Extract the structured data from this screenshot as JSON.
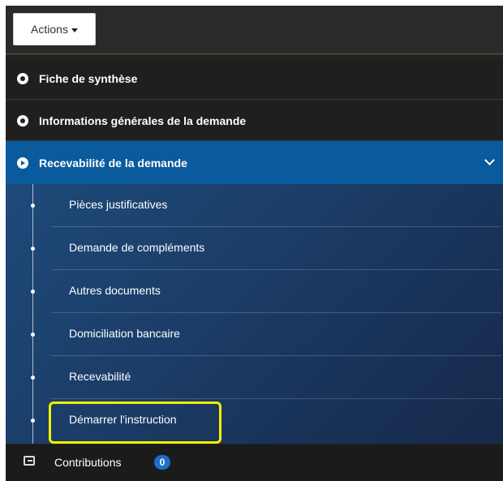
{
  "actions": {
    "label": "Actions"
  },
  "sections": [
    {
      "label": "Fiche de synthèse"
    },
    {
      "label": "Informations générales de la demande"
    },
    {
      "label": "Recevabilité de la demande",
      "expanded": true
    }
  ],
  "submenu": [
    {
      "label": "Pièces justificatives"
    },
    {
      "label": "Demande de compléments"
    },
    {
      "label": "Autres documents"
    },
    {
      "label": "Domiciliation bancaire"
    },
    {
      "label": "Recevabilité"
    },
    {
      "label": "Démarrer l'instruction",
      "highlighted": true
    }
  ],
  "footer": {
    "label": "Contributions",
    "count": "0"
  },
  "colors": {
    "active_section": "#0a5b9e",
    "highlight": "#f4f000",
    "badge": "#1d6fc7"
  },
  "icons": [
    "caret-down-icon",
    "circle-dot-icon",
    "arrow-circle-icon",
    "chevron-down-icon",
    "comment-icon"
  ]
}
